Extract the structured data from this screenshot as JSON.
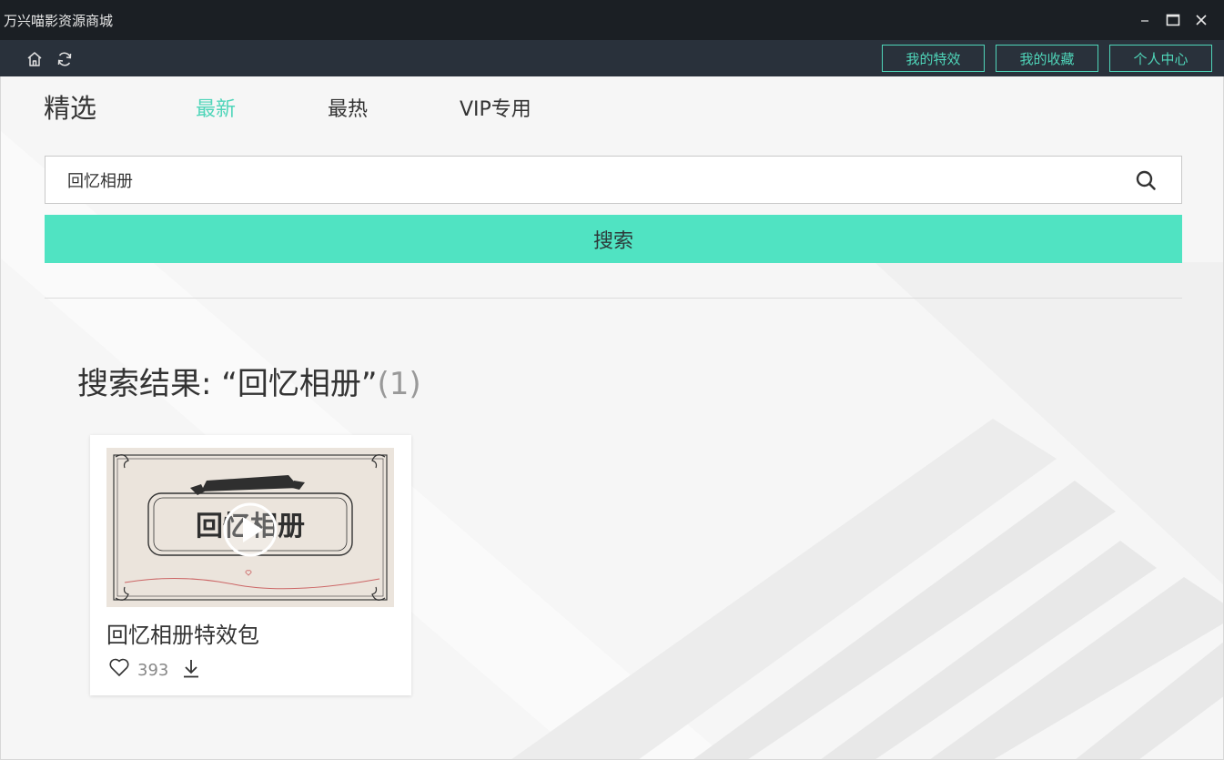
{
  "window": {
    "title": "万兴喵影资源商城",
    "controls": [
      "minimize",
      "maximize",
      "close"
    ]
  },
  "toolbar": {
    "icons": [
      "home-icon",
      "refresh-icon"
    ],
    "buttons": [
      "我的特效",
      "我的收藏",
      "个人中心"
    ],
    "accent_color": "#4fd5b9"
  },
  "nav": {
    "title": "精选",
    "tabs": [
      {
        "label": "最新",
        "active": true
      },
      {
        "label": "最热",
        "active": false
      },
      {
        "label": "VIP专用",
        "active": false
      }
    ]
  },
  "search": {
    "value": "回忆相册",
    "button_label": "搜索",
    "button_color": "#50e3c2"
  },
  "results": {
    "heading": "搜索结果: “回忆相册”",
    "count": "(1)",
    "items": [
      {
        "title": "回忆相册特效包",
        "thumbnail_text": "回忆相册",
        "likes": "393"
      }
    ]
  }
}
